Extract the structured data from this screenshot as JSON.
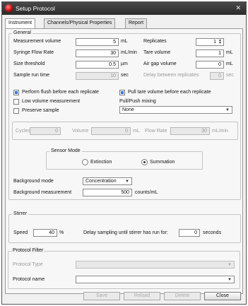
{
  "window": {
    "title": "Setup Protocol"
  },
  "tabs": [
    "Instrument",
    "Channels/Physical Properties",
    "Report"
  ],
  "general": {
    "legend": "General",
    "measurement_volume": {
      "label": "Measurement volume",
      "value": "5",
      "unit": "mL"
    },
    "syringe_flow_rate": {
      "label": "Syringe Flow Rate",
      "value": "30",
      "unit": "mL/min"
    },
    "size_threshold": {
      "label": "Size threshold",
      "value": "0.5",
      "unit": "µm"
    },
    "sample_run_time": {
      "label": "Sample run time",
      "value": "10",
      "unit": "sec"
    },
    "replicates": {
      "label": "Replicates",
      "value": "1"
    },
    "tare_volume": {
      "label": "Tare volume",
      "value": "1",
      "unit": "mL"
    },
    "air_gap_volume": {
      "label": "Air gap volume",
      "value": "0",
      "unit": "mL"
    },
    "delay_between_replicates": {
      "label": "Delay between replicates",
      "value": "0",
      "unit": "sec"
    },
    "perform_flush": "Perform flush before each replicate",
    "pull_tare": "Pull tare volume before each replicate",
    "low_volume": "Low volume measurement",
    "preserve_sample": "Preserve sample",
    "pull_push_label": "Pull/Push mixing",
    "pull_push_value": "None",
    "cycles": {
      "label": "Cycles",
      "value": "0"
    },
    "volume": {
      "label": "Volume",
      "value": "0",
      "unit": "mL"
    },
    "flow_rate": {
      "label": "Flow Rate",
      "value": "30",
      "unit": "mL/min"
    }
  },
  "sensor_mode": {
    "legend": "Sensor Mode",
    "options": [
      "Extinction",
      "Summation"
    ],
    "selected": "Summation"
  },
  "background": {
    "mode_label": "Background mode",
    "mode_value": "Concentration",
    "measurement_label": "Background measurement",
    "measurement_value": "500",
    "measurement_unit": "counts/mL"
  },
  "stirrer": {
    "legend": "Stirrer",
    "speed_label": "Speed",
    "speed_value": "40",
    "speed_unit": "%",
    "delay_label": "Delay sampling until stirrer has run for:",
    "delay_value": "0",
    "delay_unit": "seconds"
  },
  "protocol_filter": {
    "legend": "Protocol Filter",
    "type_label": "Protocol Type",
    "type_value": "",
    "name_label": "Protocol name",
    "name_value": ""
  },
  "buttons": {
    "save": "Save",
    "reload": "Reload",
    "delete": "Delete",
    "close": "Close"
  }
}
